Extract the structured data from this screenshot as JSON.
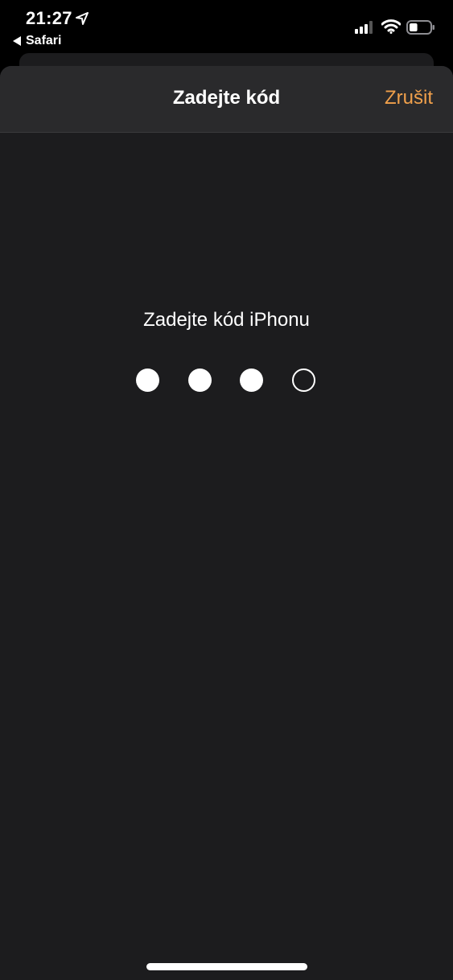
{
  "status_bar": {
    "time": "21:27",
    "back_app": "Safari",
    "location_icon": "location-arrow-icon",
    "signal_icon": "cellular-signal-icon",
    "wifi_icon": "wifi-icon",
    "battery_icon": "battery-icon",
    "battery_level": 0.4
  },
  "nav": {
    "title": "Zadejte kód",
    "cancel_label": "Zrušit"
  },
  "passcode": {
    "prompt": "Zadejte kód iPhonu",
    "length": 4,
    "entered": 3
  },
  "colors": {
    "accent": "#f0a04b",
    "sheet_background": "#1c1c1e",
    "nav_background": "#2a2a2c"
  }
}
